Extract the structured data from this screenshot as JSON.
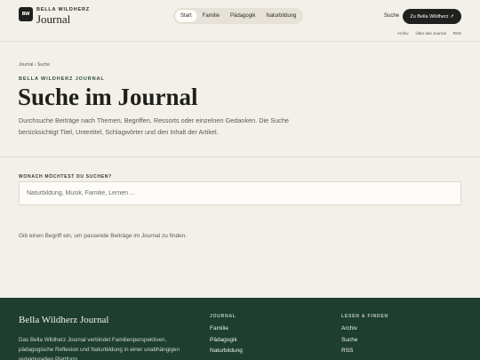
{
  "header": {
    "logo_text": "BW",
    "brand_top": "BELLA WILDHERZ",
    "brand_main": "Journal",
    "nav": [
      "Start",
      "Familie",
      "Pädagogik",
      "Naturbildung"
    ],
    "search_label": "Suche",
    "cta_label": "Zu Bella Wildherz ↗",
    "sublinks": [
      "Archiv",
      "Über das Journal",
      "RSS"
    ]
  },
  "main": {
    "breadcrumb": "Journal › Suche",
    "eyebrow": "BELLA WILDHERZ JOURNAL",
    "title": "Suche im Journal",
    "intro": "Durchsuche Beiträge nach Themen, Begriffen, Ressorts oder einzelnen Gedanken. Die Suche berücksichtigt Titel, Untertitel, Schlagwörter und den Inhalt der Artikel.",
    "field_label": "WONACH MÖCHTEST DU SUCHEN?",
    "search_placeholder": "Naturbildung, Musik, Familie, Lernen ...",
    "hint": "Gib einen Begriff ein, um passende Beiträge im Journal zu finden."
  },
  "footer": {
    "title": "Bella Wildherz Journal",
    "desc": "Das Bella Wildherz Journal verbindet Familienperspektiven, pädagogische Reflexion und Naturbildung in einer unabhängigen redaktionellen Plattform.",
    "col1_head": "JOURNAL",
    "col1_links": [
      "Familie",
      "Pädagogik",
      "Naturbildung"
    ],
    "col2_head": "LESEN & FINDEN",
    "col2_links": [
      "Archiv",
      "Suche",
      "RSS"
    ]
  }
}
